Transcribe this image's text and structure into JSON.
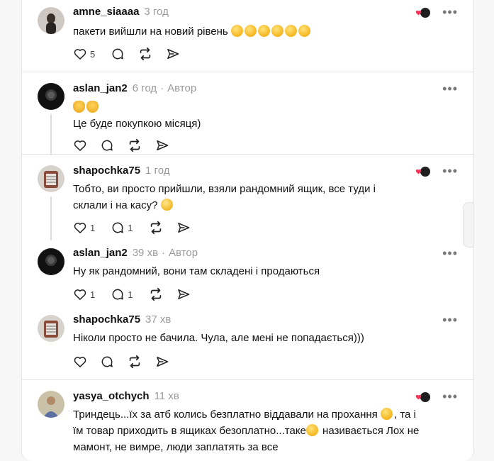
{
  "comments": [
    {
      "user": "amne_siaaaa",
      "time": "3 год",
      "author_badge": "",
      "text": "пакети вийшли на новий рівень",
      "emojis": [
        "rofl",
        "rofl",
        "rofl",
        "rofl",
        "rofl",
        "rofl"
      ],
      "like_count": "5",
      "reply_count": ""
    },
    {
      "user": "aslan_jan2",
      "time": "6 год",
      "author_badge": "Автор",
      "line1": "",
      "text": "Це буде покупкою місяця)",
      "like_count": "",
      "reply_count": ""
    },
    {
      "user": "shapochka75",
      "time": "1 год",
      "author_badge": "",
      "text": "Тобто, ви просто прийшли, взяли рандомний ящик, все туди і склали і на касу?",
      "like_count": "1",
      "reply_count": "1"
    },
    {
      "user": "aslan_jan2",
      "time": "39 хв",
      "author_badge": "Автор",
      "text": "Ну як рандомний, вони там складені і продаються",
      "like_count": "1",
      "reply_count": "1"
    },
    {
      "user": "shapochka75",
      "time": "37 хв",
      "author_badge": "",
      "text": "Ніколи просто не бачила. Чула, але мені не попадається)))",
      "like_count": "",
      "reply_count": ""
    },
    {
      "user": "yasya_otchych",
      "time": "11 хв",
      "author_badge": "",
      "text_a": "Триндець...їх за атб колись безплатно віддавали на прохання",
      "text_b": ", та і їм товар приходить в ящиках безоплатно...таке",
      "text_c": " називається Лох не мамонт, не вимре, люди заплатять за все",
      "like_count": "",
      "reply_count": ""
    }
  ],
  "dot_separator": "·",
  "more_glyph": "•••",
  "icons": [
    "heart-icon",
    "comment-icon",
    "repost-icon",
    "share-icon",
    "more-icon",
    "liked-by-author-icon"
  ],
  "colors": {
    "accent_red": "#ff2f55",
    "muted": "#9a9a9a",
    "separator": "#e3e3e3"
  }
}
